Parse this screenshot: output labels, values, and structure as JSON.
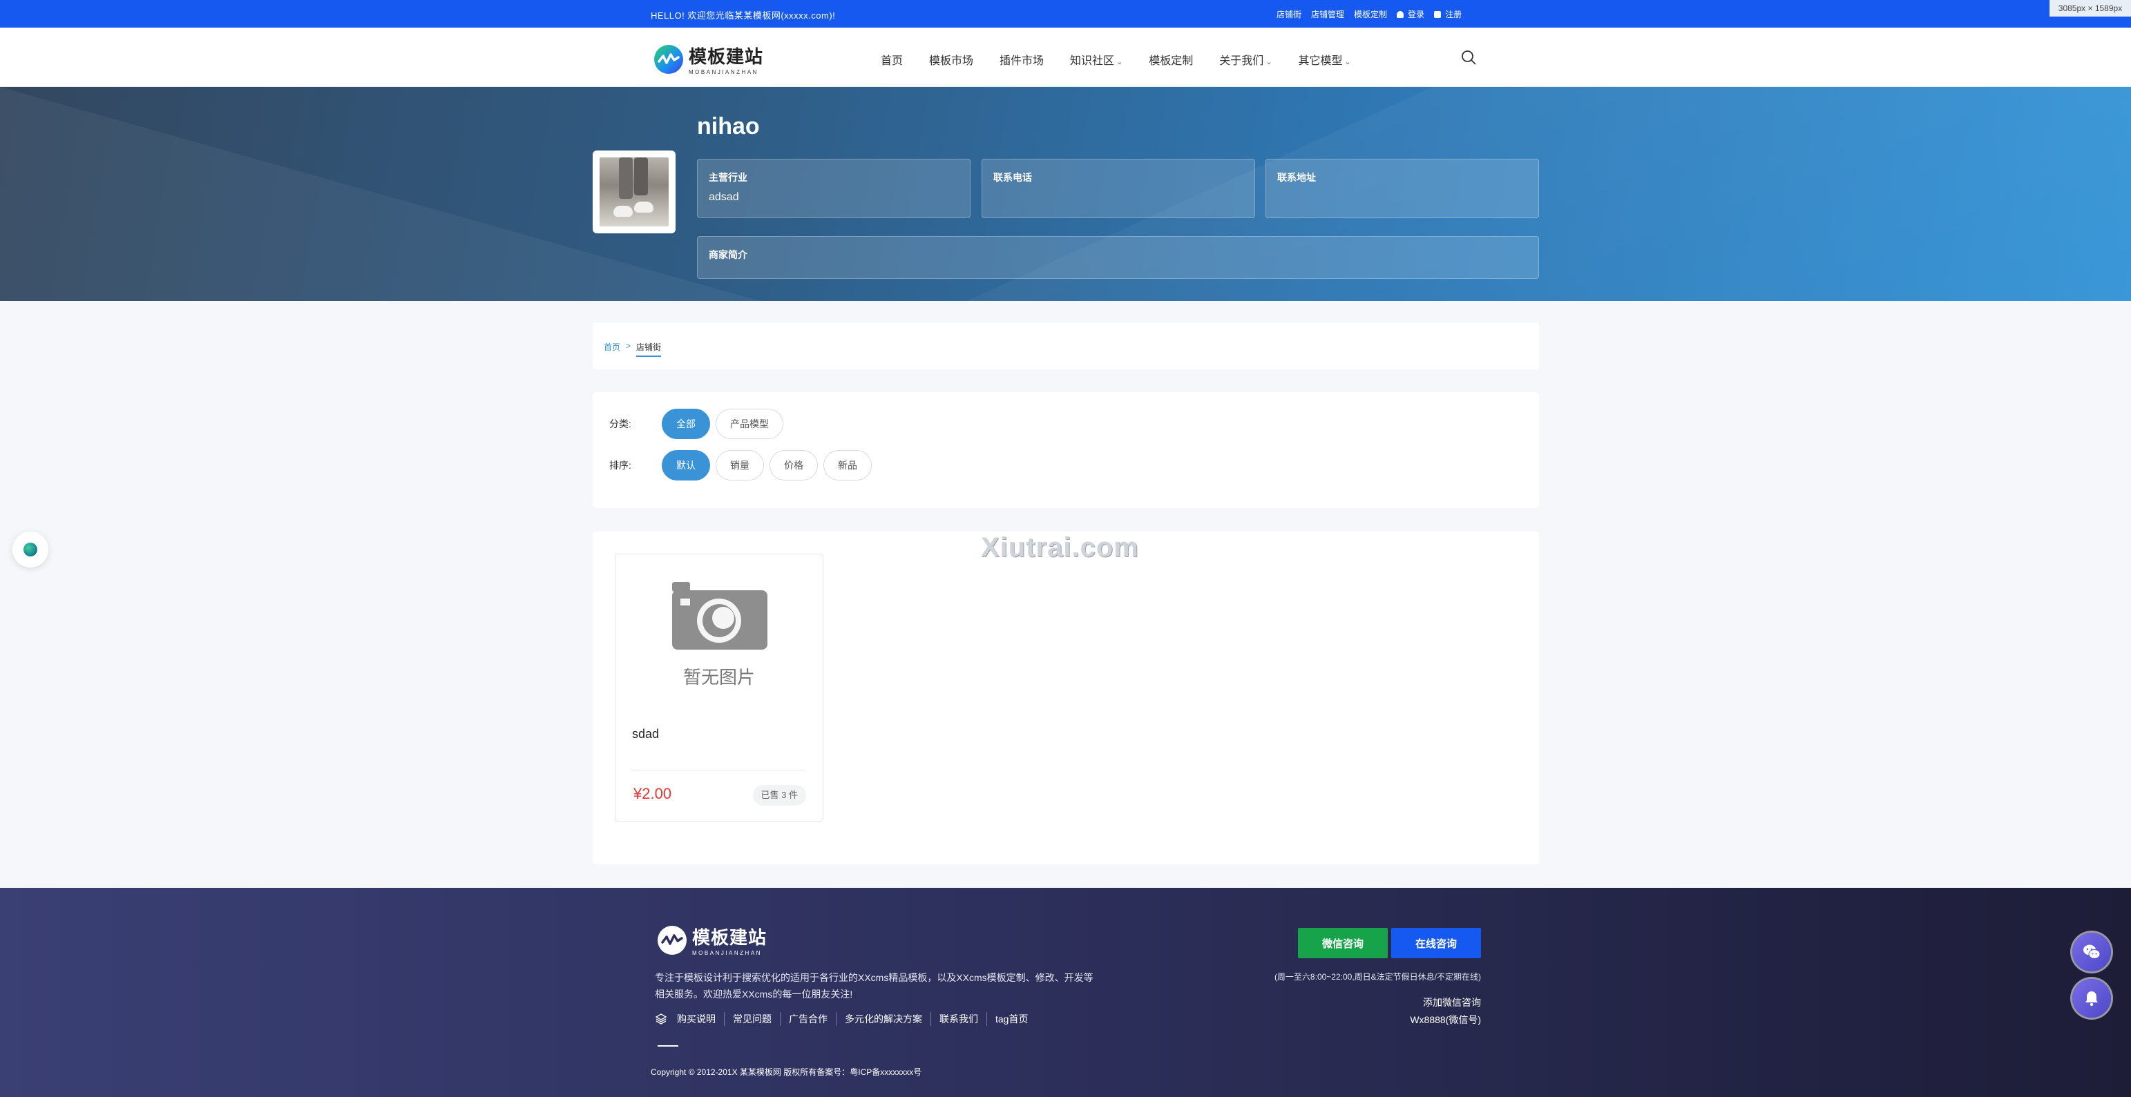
{
  "topbar": {
    "hello": "HELLO!  欢迎您光临某某模板网(xxxxx.com)!",
    "links": [
      "店铺街",
      "店铺管理",
      "模板定制"
    ],
    "login": "登录",
    "register": "注册",
    "dimensions": "3085px × 1589px"
  },
  "brand": {
    "name_cn": "模板建站",
    "name_en": "MOBANJIANZHAN"
  },
  "nav": {
    "items": [
      "首页",
      "模板市场",
      "插件市场",
      "知识社区",
      "模板定制",
      "关于我们",
      "其它模型"
    ]
  },
  "shop": {
    "name": "nihao",
    "industry_label": "主营行业",
    "industry_value": "adsad",
    "phone_label": "联系电话",
    "phone_value": "",
    "address_label": "联系地址",
    "address_value": "",
    "intro_label": "商家简介"
  },
  "breadcrumb": {
    "home": "首页",
    "sep": ">",
    "current": "店铺街"
  },
  "filter": {
    "category_label": "分类:",
    "categories": [
      "全部",
      "产品模型"
    ],
    "sort_label": "排序:",
    "sorts": [
      "默认",
      "销量",
      "价格",
      "新品"
    ]
  },
  "watermark": "Xiutrai.com",
  "product": {
    "no_image_text": "暂无图片",
    "title": "sdad",
    "price": "¥2.00",
    "sold": "已售 3 件"
  },
  "footer": {
    "desc": "专注于模板设计利于搜索优化的适用于各行业的XXcms精品模板，以及XXcms模板定制、修改、开发等相关服务。欢迎热爱XXcms的每一位朋友关注!",
    "links": [
      "购买说明",
      "常见问题",
      "广告合作",
      "多元化的解决方案",
      "联系我们",
      "tag首页"
    ],
    "copyright": "Copyright © 2012-201X 某某模板网 版权所有备案号：粤ICP备xxxxxxxx号",
    "wechat_btn": "微信咨询",
    "online_btn": "在线咨询",
    "hours": "(周一至六8:00~22:00,周日&法定节假日休息/不定期在线)",
    "wechat_add": "添加微信咨询",
    "wechat_id": "Wx8888(微信号)"
  },
  "colors": {
    "primary_blue": "#1559f0",
    "accent": "#3a93d6",
    "price_red": "#e53935",
    "wechat_green": "#16a34a"
  }
}
